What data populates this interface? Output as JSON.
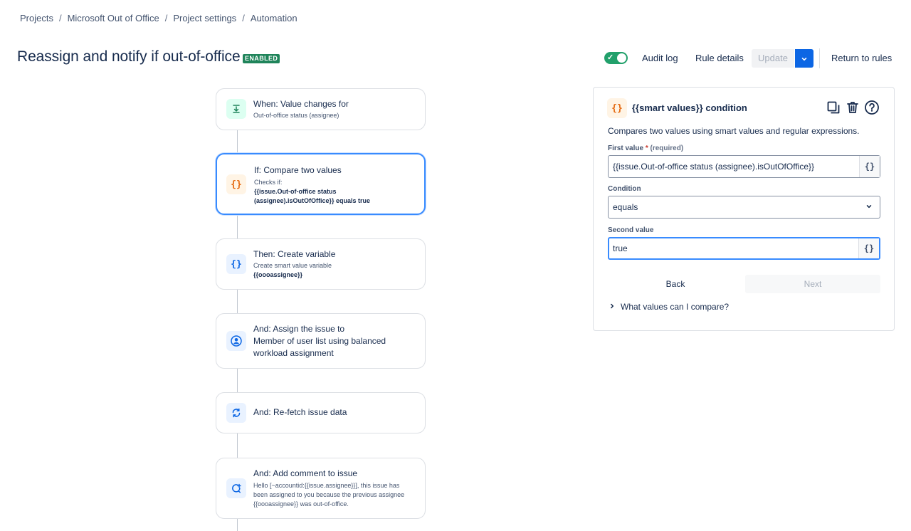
{
  "breadcrumb": [
    "Projects",
    "Microsoft Out of Office",
    "Project settings",
    "Automation"
  ],
  "breadcrumb_separator": "/",
  "header": {
    "title": "Reassign and notify if out-of-office",
    "status": "ENABLED",
    "toggle_on": true,
    "audit_log": "Audit log",
    "rule_details": "Rule details",
    "update": "Update",
    "return_to_rules": "Return to rules"
  },
  "flow": {
    "trigger": {
      "title": "When: Value changes for",
      "sub": "Out-of-office status (assignee)"
    },
    "condition": {
      "title": "If: Compare two values",
      "sub_prefix": "Checks if:",
      "sub_value": "{{issue.Out-of-office status (assignee).isOutOfOffice}} equals true"
    },
    "create_variable": {
      "title": "Then: Create variable",
      "sub_prefix": "Create smart value variable",
      "sub_value": "{{oooassignee}}"
    },
    "assign": {
      "title": "And: Assign the issue to",
      "body": "Member of user list using balanced workload assignment"
    },
    "refetch": {
      "title": "And: Re-fetch issue data"
    },
    "comment": {
      "title": "And: Add comment to issue",
      "sub": "Hello [~accountid:{{issue.assignee}}], this issue has been assigned to you because the previous assignee {{oooassignee}} was out-of-office."
    }
  },
  "panel": {
    "icon_text": "{}",
    "title": "{{smart values}} condition",
    "description": "Compares two values using smart values and regular expressions.",
    "first_value_label": "First value",
    "required_mark": "*",
    "required_text": "(required)",
    "first_value": "{{issue.Out-of-office status (assignee).isOutOfOffice}}",
    "condition_label": "Condition",
    "condition_value": "equals",
    "second_value_label": "Second value",
    "second_value": "true",
    "smart_value_btn": "{}",
    "back": "Back",
    "next": "Next",
    "help_expander": "What values can I compare?"
  },
  "colors": {
    "accent": "#0c66e4",
    "success": "#1f845a",
    "toggle": "#22a06b",
    "selected_border": "#388bff"
  }
}
